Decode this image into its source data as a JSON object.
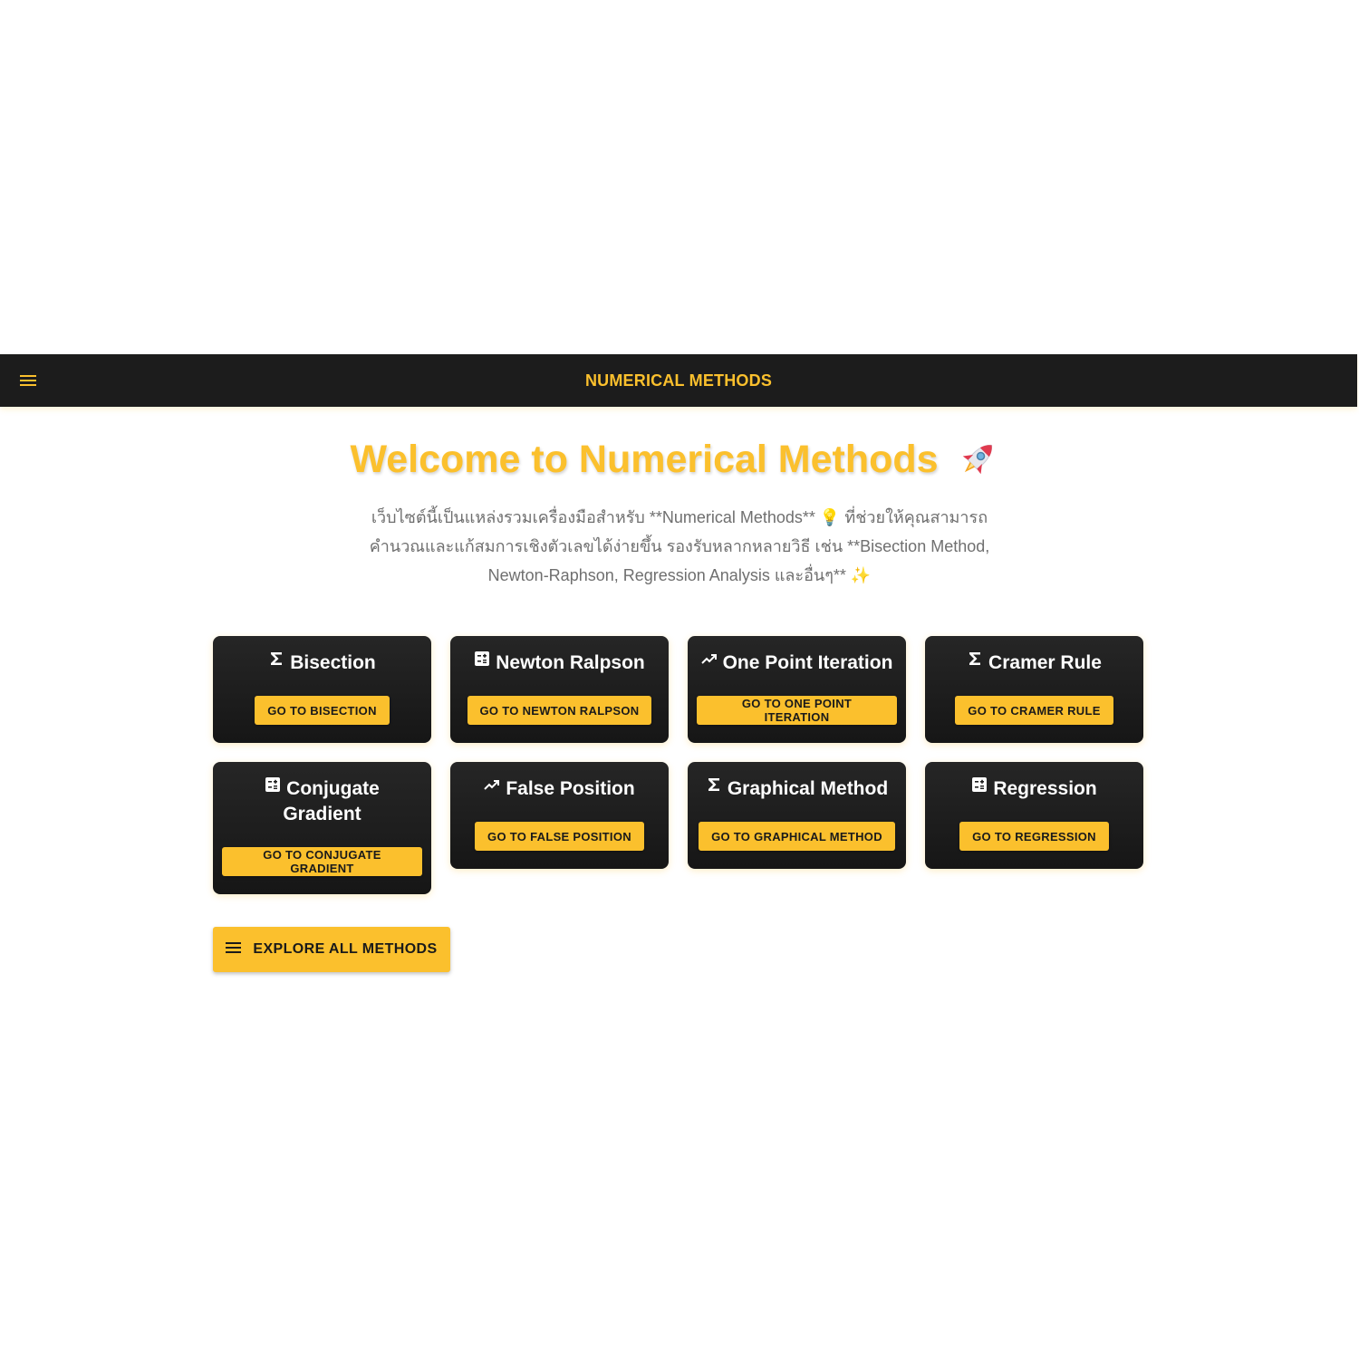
{
  "appbar": {
    "title": "NUMERICAL METHODS",
    "menu_icon": "hamburger-menu-icon"
  },
  "hero": {
    "title": "Welcome to Numerical Methods",
    "title_icon": "rocket-icon",
    "description": "เว็บไซต์นี้เป็นแหล่งรวมเครื่องมือสำหรับ **Numerical Methods** 💡 ที่ช่วยให้คุณสามารถคำนวณและแก้สมการเชิงตัวเลขได้ง่ายขึ้น รองรับหลากหลายวิธี เช่น **Bisection Method, Newton-Raphson, Regression Analysis และอื่นๆ** ✨"
  },
  "methods": [
    {
      "title": "Bisection",
      "icon": "sigma-icon",
      "button": "GO TO BISECTION"
    },
    {
      "title": "Newton Ralpson",
      "icon": "calculator-icon",
      "button": "GO TO NEWTON RALPSON"
    },
    {
      "title": "One Point Iteration",
      "icon": "trending-up-icon",
      "button": "GO TO ONE POINT ITERATION"
    },
    {
      "title": "Cramer Rule",
      "icon": "sigma-icon",
      "button": "GO TO CRAMER RULE"
    },
    {
      "title": "Conjugate Gradient",
      "icon": "calculator-icon",
      "button": "GO TO CONJUGATE GRADIENT"
    },
    {
      "title": "False Position",
      "icon": "trending-up-icon",
      "button": "GO TO FALSE POSITION"
    },
    {
      "title": "Graphical Method",
      "icon": "sigma-icon",
      "button": "GO TO GRAPHICAL METHOD"
    },
    {
      "title": "Regression",
      "icon": "calculator-icon",
      "button": "GO TO REGRESSION"
    }
  ],
  "explore": {
    "label": "EXPLORE ALL METHODS",
    "icon": "menu-icon"
  },
  "colors": {
    "accent": "#fbc02d",
    "appbar_bg": "#1c1c1c",
    "card_bg": "#1e1e1e",
    "text_muted": "#6f6f6f"
  }
}
